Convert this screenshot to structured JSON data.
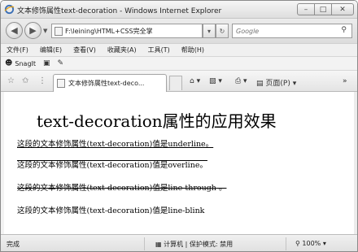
{
  "window": {
    "title": "文本修饰属性text-decoration - Windows Internet Explorer",
    "minimize_glyph": "–",
    "maximize_glyph": "□",
    "close_glyph": "✕"
  },
  "address_bar": {
    "url": "F:\\leining\\HTML+CSS完全掌",
    "search_placeholder": "Google"
  },
  "menu": {
    "items": [
      "文件(F)",
      "编辑(E)",
      "查看(V)",
      "收藏夹(A)",
      "工具(T)",
      "帮助(H)"
    ]
  },
  "links_bar": {
    "snagit_label": "SnagIt"
  },
  "tab": {
    "label": "文本修饰属性text-deco..."
  },
  "command_bar": {
    "page_label": "页面(P)"
  },
  "page": {
    "heading": "text-decoration属性的应用效果",
    "lines": [
      "这段的文本修饰属性(text-decoration)值是underline。",
      "这段的文本修饰属性(text-decoration)值是overline。",
      "这段的文本修饰属性(text-decoration)值是line-through 。",
      "这段的文本修饰属性(text-decoration)值是line-blink"
    ]
  },
  "status": {
    "text": "完成",
    "zone": "计算机 | 保护模式: 禁用",
    "zoom": "100%"
  }
}
